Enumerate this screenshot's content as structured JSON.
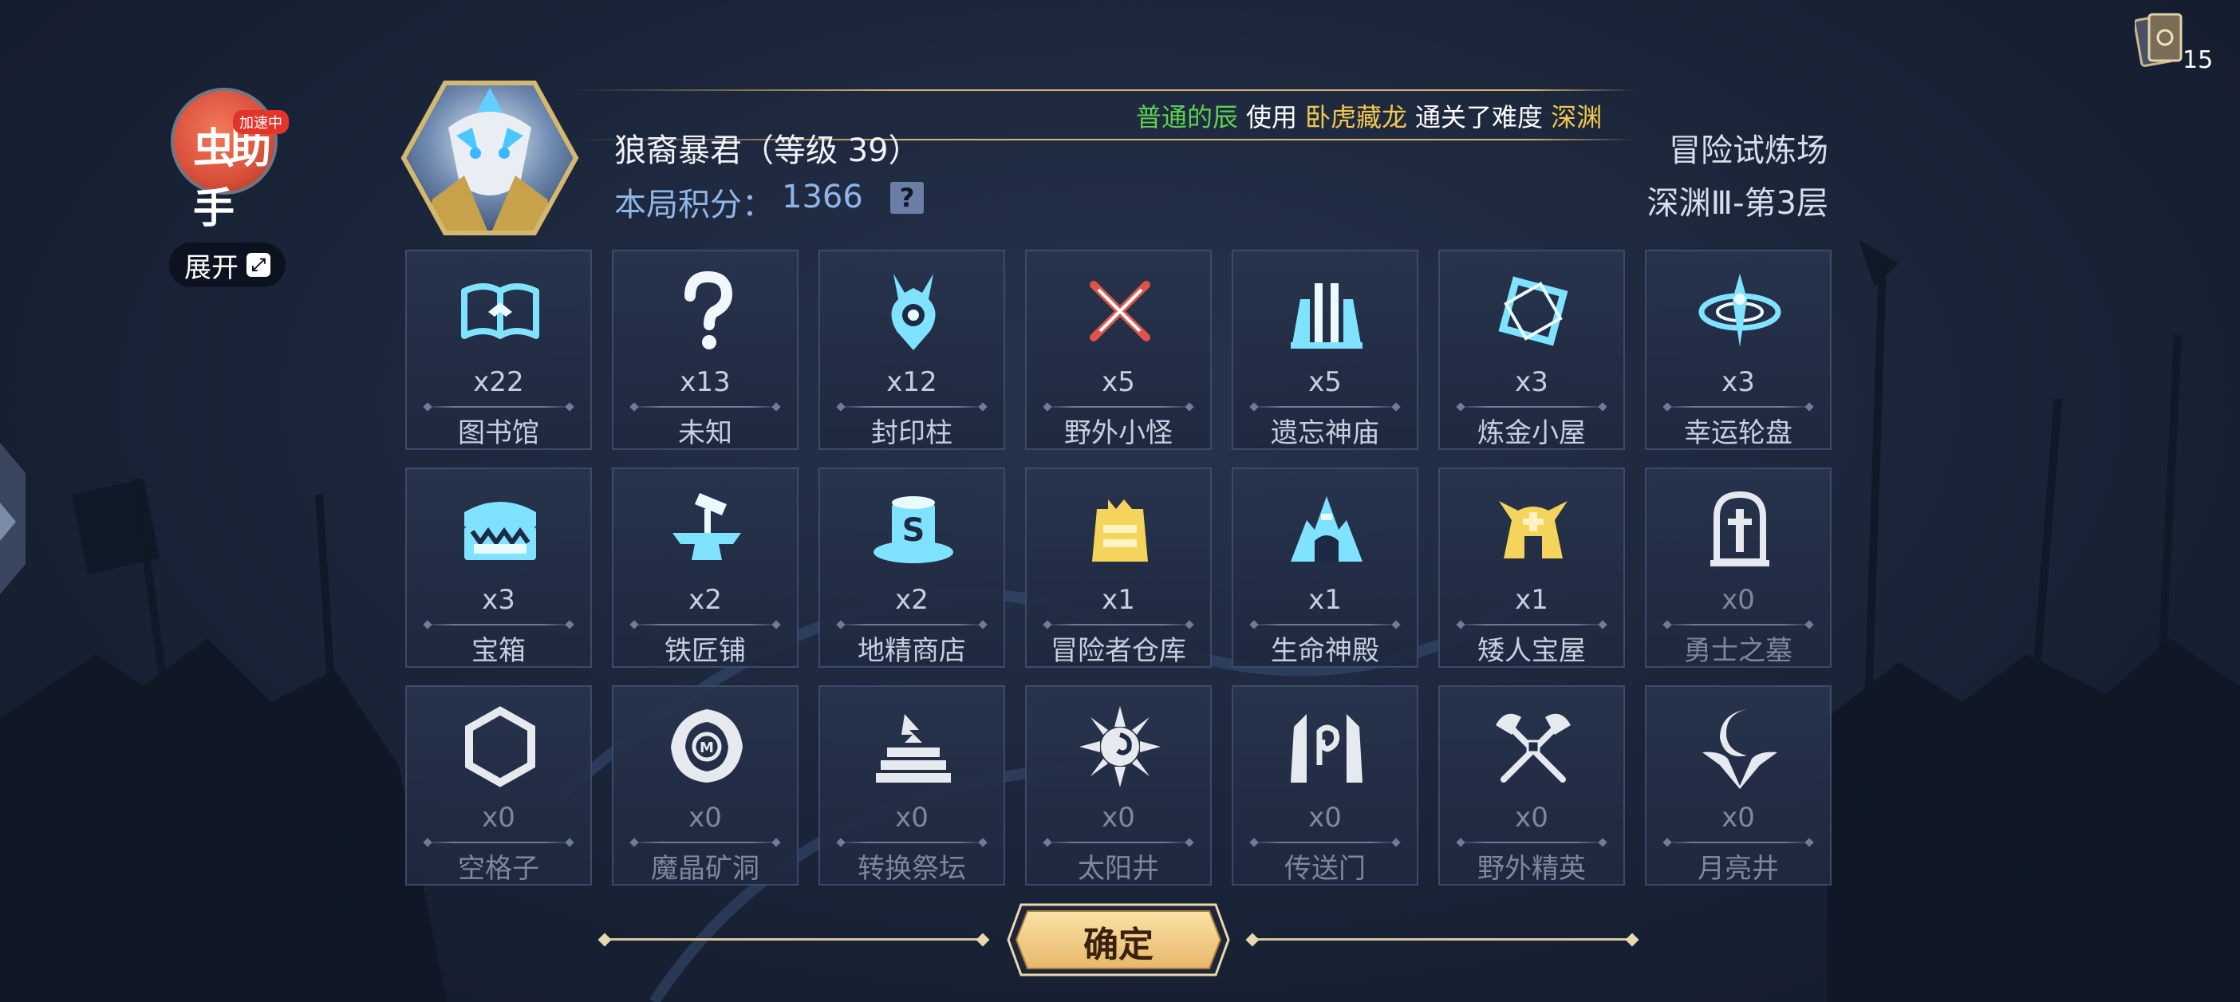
{
  "helper": {
    "char": "虫助手",
    "badge": "加速中",
    "expand_label": "展开"
  },
  "deck": {
    "count": "15"
  },
  "hero": {
    "name": "狼裔暴君（等级 39）",
    "score_label": "本局积分：",
    "score_value": "1366",
    "help": "?"
  },
  "ticker": {
    "player": "普通的辰",
    "verb": "使用",
    "hero": "卧虎藏龙",
    "text": "通关了难度",
    "level": "深渊"
  },
  "mode": {
    "name": "冒险试炼场",
    "stage": "深渊Ⅲ-第3层"
  },
  "cells": [
    {
      "count": "x22",
      "label": "图书馆",
      "icon": "book-icon"
    },
    {
      "count": "x13",
      "label": "未知",
      "icon": "question-mark-icon"
    },
    {
      "count": "x12",
      "label": "封印柱",
      "icon": "seal-pillar-icon"
    },
    {
      "count": "x5",
      "label": "野外小怪",
      "icon": "crossed-swords-icon"
    },
    {
      "count": "x5",
      "label": "遗忘神庙",
      "icon": "temple-icon"
    },
    {
      "count": "x3",
      "label": "炼金小屋",
      "icon": "alchemy-icon"
    },
    {
      "count": "x3",
      "label": "幸运轮盘",
      "icon": "wheel-icon"
    },
    {
      "count": "x3",
      "label": "宝箱",
      "icon": "chest-icon"
    },
    {
      "count": "x2",
      "label": "铁匠铺",
      "icon": "anvil-icon"
    },
    {
      "count": "x2",
      "label": "地精商店",
      "icon": "goblin-shop-icon"
    },
    {
      "count": "x1",
      "label": "冒险者仓库",
      "icon": "warehouse-icon"
    },
    {
      "count": "x1",
      "label": "生命神殿",
      "icon": "life-shrine-icon"
    },
    {
      "count": "x1",
      "label": "矮人宝屋",
      "icon": "dwarf-house-icon"
    },
    {
      "count": "x0",
      "label": "勇士之墓",
      "icon": "tomb-icon"
    },
    {
      "count": "x0",
      "label": "空格子",
      "icon": "hexagon-icon"
    },
    {
      "count": "x0",
      "label": "魔晶矿洞",
      "icon": "crystal-mine-icon"
    },
    {
      "count": "x0",
      "label": "转换祭坛",
      "icon": "altar-icon"
    },
    {
      "count": "x0",
      "label": "太阳井",
      "icon": "sun-well-icon"
    },
    {
      "count": "x0",
      "label": "传送门",
      "icon": "portal-icon"
    },
    {
      "count": "x0",
      "label": "野外精英",
      "icon": "crossed-axes-icon"
    },
    {
      "count": "x0",
      "label": "月亮井",
      "icon": "moon-well-icon"
    }
  ],
  "confirm_label": "确定",
  "colors": {
    "accent_cyan": "#7fe3ff",
    "accent_gold": "#f4d45a",
    "accent_red": "#e0534a",
    "ticker_green": "#5ed14e"
  }
}
